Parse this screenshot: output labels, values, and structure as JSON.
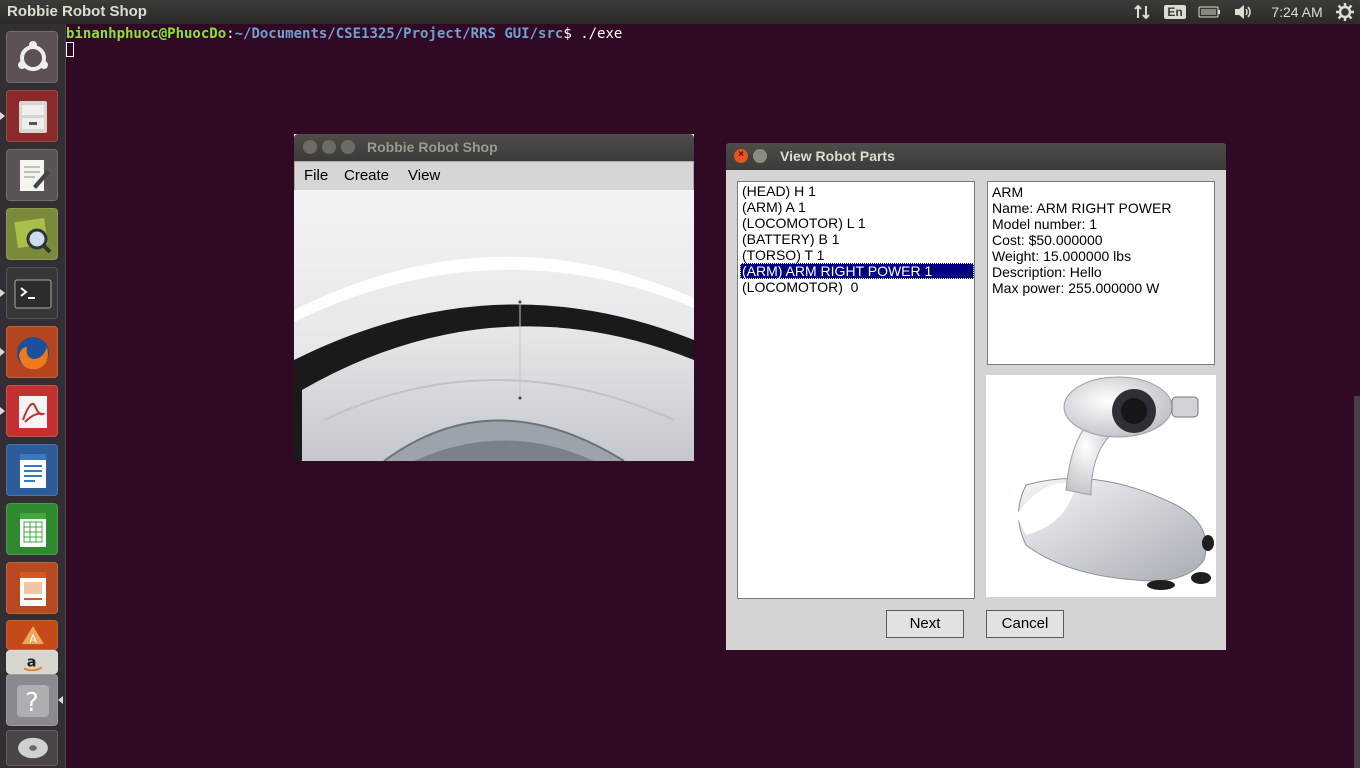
{
  "top_panel": {
    "app_title": "Robbie Robot Shop",
    "keyboard_layout": "En",
    "clock": "7:24 AM"
  },
  "terminal": {
    "user_host": "binanhphuoc@PhuocDo",
    "separator": ":",
    "path": "~/Documents/CSE1325/Project/RRS GUI/src",
    "prompt": "$ ",
    "command": "./exe"
  },
  "robbie_window": {
    "title": "Robbie Robot Shop",
    "menus": [
      "File",
      "Create",
      "View"
    ]
  },
  "view_parts_window": {
    "title": "View Robot Parts",
    "parts": [
      "(HEAD) H 1",
      "(ARM) A 1",
      "(LOCOMOTOR) L 1",
      "(BATTERY) B 1",
      "(TORSO) T 1",
      "(ARM) ARM RIGHT POWER 1",
      "(LOCOMOTOR)  0"
    ],
    "selected_index": 5,
    "details": [
      "ARM",
      "Name: ARM RIGHT POWER",
      "Model number: 1",
      "Cost: $50.000000",
      "Weight: 15.000000 lbs",
      "Description: Hello",
      "Max power: 255.000000 W"
    ],
    "next_label": "Next",
    "cancel_label": "Cancel"
  },
  "colors": {
    "desktop": "#300a24",
    "selection": "#000080",
    "close_button": "#e95420"
  }
}
